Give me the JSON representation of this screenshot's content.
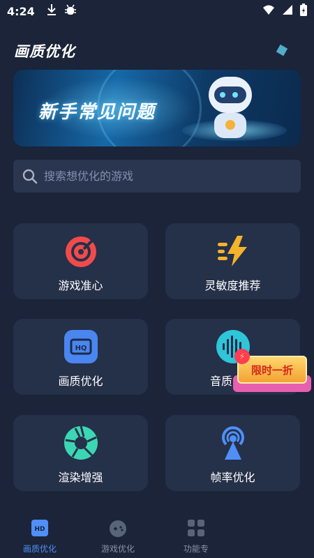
{
  "status_bar": {
    "time": "4:24",
    "icons": [
      "download-icon",
      "bug-icon",
      "wifi-icon",
      "signal-icon",
      "battery-icon"
    ]
  },
  "page": {
    "title": "画质优化"
  },
  "banner": {
    "text": "新手常见问题"
  },
  "search": {
    "placeholder": "搜索想优化的游戏"
  },
  "features": [
    {
      "label": "游戏准心",
      "icon": "crosshair-target-icon",
      "color": "#f04b4b"
    },
    {
      "label": "灵敏度推荐",
      "icon": "lightning-speed-icon",
      "color": "#f5b32c"
    },
    {
      "label": "画质优化",
      "icon": "hd-icon",
      "color": "#4a86f0"
    },
    {
      "label": "音质",
      "icon": "sound-wave-icon",
      "color": "#2ec6d8"
    },
    {
      "label": "渲染增强",
      "icon": "aperture-icon",
      "color": "#3dd6b4"
    },
    {
      "label": "帧率优化",
      "icon": "broadcast-tower-icon",
      "color": "#4f8ff7"
    }
  ],
  "promo": {
    "label": "限时一折"
  },
  "bottom_nav": [
    {
      "label": "画质优化",
      "icon": "hd-icon",
      "active": true
    },
    {
      "label": "游戏优化",
      "icon": "gamepad-icon",
      "active": false
    },
    {
      "label": "功能专",
      "icon": "grid-icon",
      "active": false
    },
    {
      "label": "",
      "icon": "",
      "active": false
    }
  ],
  "colors": {
    "background": "#1b2438",
    "card": "#253049",
    "accent": "#4f8ff7"
  }
}
